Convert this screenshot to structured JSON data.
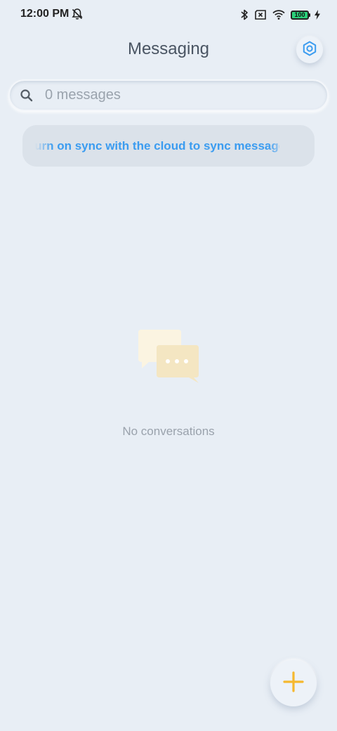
{
  "status_bar": {
    "time": "12:00 PM",
    "battery_level": "100",
    "icons": [
      "alarm-off-icon",
      "bluetooth-icon",
      "sim-off-icon",
      "wifi-icon",
      "battery-icon",
      "charging-icon"
    ]
  },
  "header": {
    "title": "Messaging",
    "settings_icon": "settings-icon"
  },
  "search": {
    "placeholder": "0 messages",
    "value": ""
  },
  "sync_banner": {
    "text": "Turn on sync with the cloud to sync messages"
  },
  "empty_state": {
    "icon": "chat-bubbles-icon",
    "text": "No conversations"
  },
  "fab": {
    "icon": "plus-icon"
  },
  "colors": {
    "background": "#e8eef5",
    "accent_blue": "#3b9cf0",
    "fab_yellow": "#f5b82e",
    "text_muted": "#9aa2ac"
  }
}
